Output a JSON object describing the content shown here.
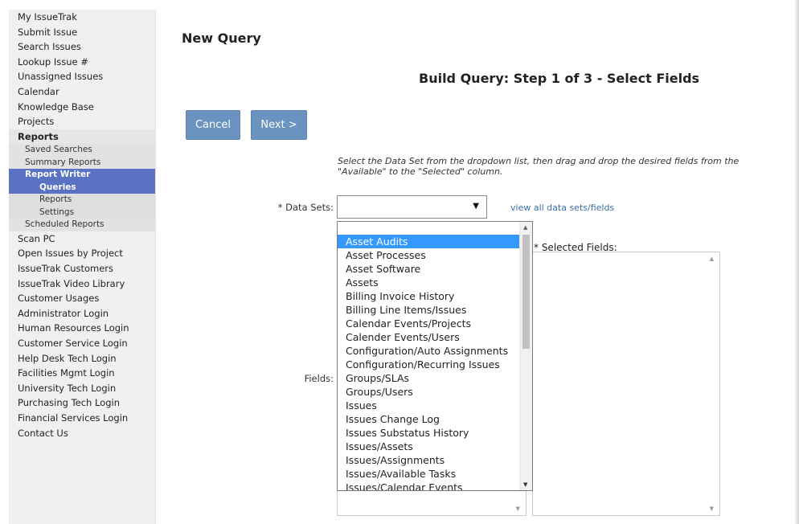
{
  "sidebar": {
    "items_top": [
      "My IssueTrak",
      "Submit Issue",
      "Search Issues",
      "Lookup Issue #",
      "Unassigned Issues",
      "Calendar",
      "Knowledge Base",
      "Projects"
    ],
    "reports": {
      "label": "Reports",
      "sub": [
        "Saved Searches",
        "Summary Reports"
      ],
      "report_writer": {
        "label": "Report Writer",
        "sub": [
          "Queries",
          "Reports",
          "Settings"
        ]
      },
      "scheduled": "Scheduled Reports"
    },
    "items_bottom": [
      "Scan PC",
      "Open Issues by Project",
      "IssueTrak Customers",
      "IssueTrak Video Library",
      "Customer Usages",
      "Administrator Login",
      "Human Resources Login",
      "Customer Service Login",
      "Help Desk Tech Login",
      "Facilities Mgmt Login",
      "University Tech Login",
      "Purchasing Tech Login",
      "Financial Services Login",
      "Contact Us"
    ]
  },
  "main": {
    "page_title": "New Query",
    "step_title": "Build Query: Step 1 of 3 - Select Fields",
    "cancel_label": "Cancel",
    "next_label": "Next >",
    "instructions_line1": "Select the Data Set from the dropdown list, then drag and drop the desired fields from the",
    "instructions_line2": "\"Available\" to the \"Selected\" column.",
    "data_sets_label": "* Data Sets:",
    "data_sets_value": "",
    "view_all_link": "view all data sets/fields",
    "fields_label": "Fields:",
    "selected_fields_label": "* Selected Fields:"
  },
  "dropdown": {
    "options": [
      "Asset Audits",
      "Asset Processes",
      "Asset Software",
      "Assets",
      "Billing Invoice History",
      "Billing Line Items/Issues",
      "Calendar Events/Projects",
      "Calender Events/Users",
      "Configuration/Auto Assignments",
      "Configuration/Recurring Issues",
      "Groups/SLAs",
      "Groups/Users",
      "Issues",
      "Issues Change Log",
      "Issues Substatus History",
      "Issues/Assets",
      "Issues/Assignments",
      "Issues/Available Tasks",
      "Issues/Calendar Events"
    ],
    "highlighted": "Asset Audits"
  },
  "colors": {
    "accent": "#5a72c4",
    "button": "#6a93bf",
    "highlight": "#3399ff",
    "link": "#3a6ea5"
  }
}
